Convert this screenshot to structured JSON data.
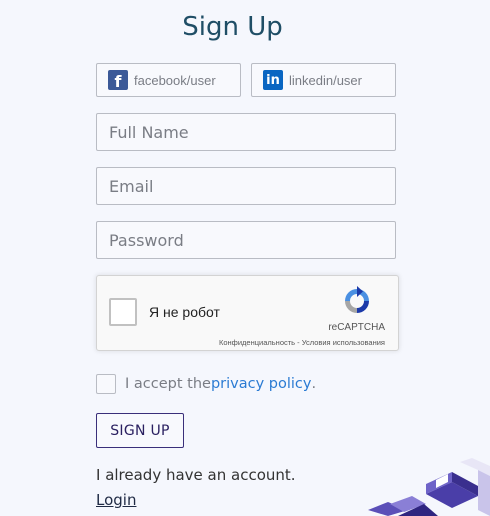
{
  "page": {
    "title": "Sign Up"
  },
  "social": {
    "facebook": {
      "label": "facebook/user",
      "icon": "facebook-icon"
    },
    "linkedin": {
      "label": "linkedin/user",
      "icon": "linkedin-icon"
    }
  },
  "form": {
    "full_name_placeholder": "Full Name",
    "email_placeholder": "Email",
    "password_placeholder": "Password"
  },
  "captcha": {
    "label": "Я не робот",
    "brand": "reCAPTCHA",
    "terms": "Конфиденциальность - Условия использования"
  },
  "agree": {
    "text": "I accept the ",
    "link": "privacy policy",
    "suffix": "."
  },
  "buttons": {
    "signup": "SIGN UP"
  },
  "footer": {
    "already": "I already have an account.",
    "login": "Login"
  },
  "colors": {
    "background": "#f5f7fd",
    "title": "#1f4e66",
    "accent": "#2a2060",
    "link": "#2b7bd3",
    "facebook": "#3b5998",
    "linkedin": "#0a66c2"
  }
}
